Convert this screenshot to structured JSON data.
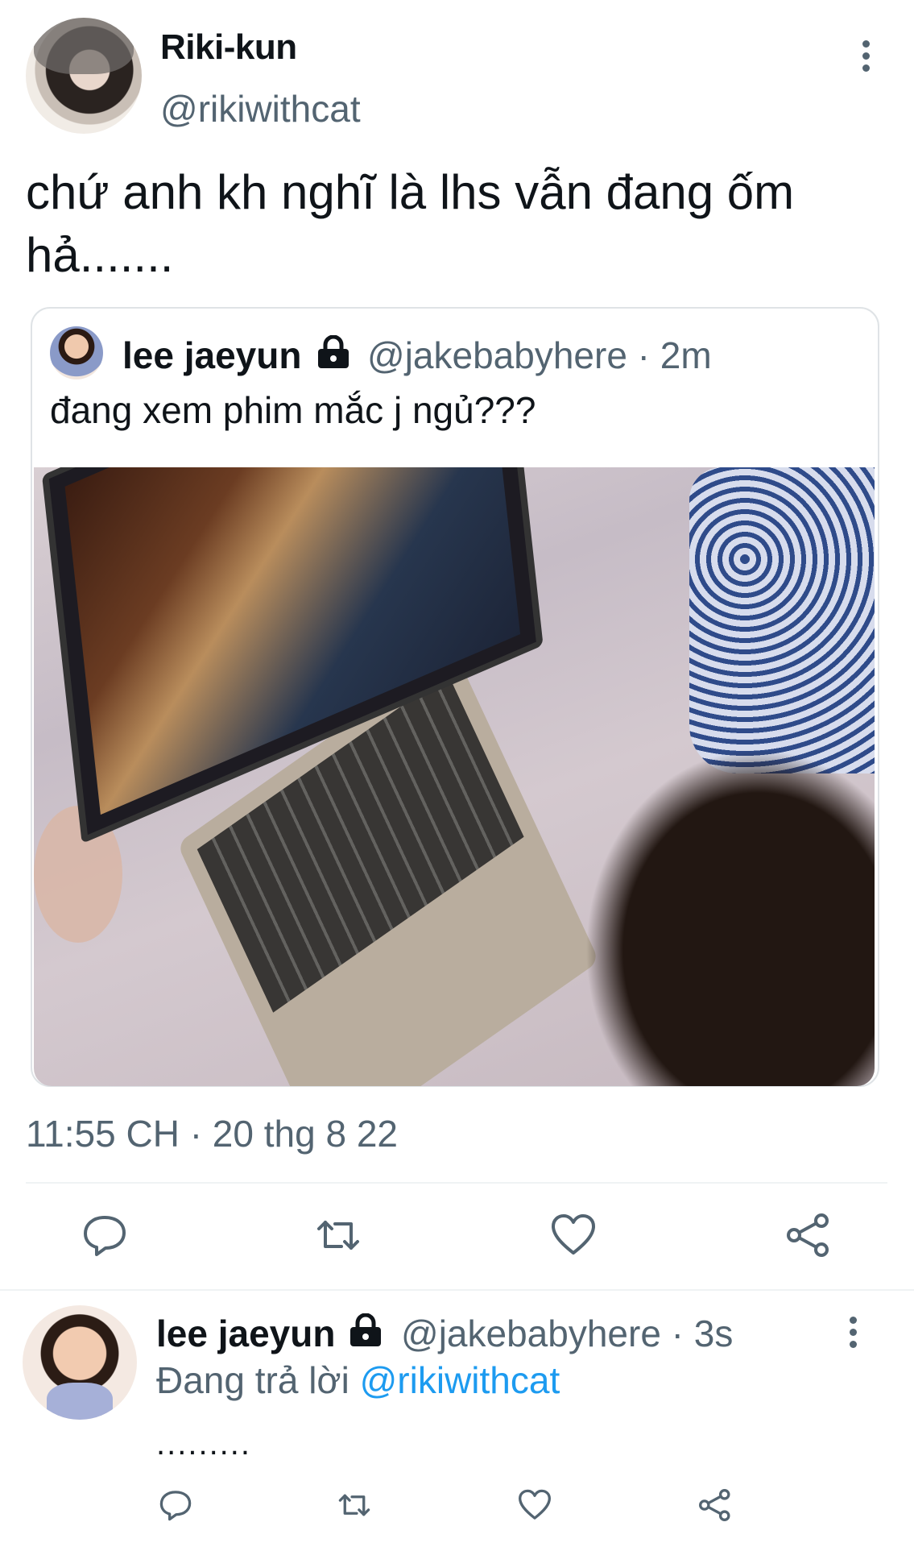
{
  "tweet": {
    "display_name": "Riki-kun",
    "handle": "@rikiwithcat",
    "text": "chứ anh kh nghĩ là lhs vẫn đang ốm hả.......",
    "timestamp": "11:55 CH · 20 thg 8 22"
  },
  "quote": {
    "display_name": "lee jaeyun",
    "handle_time": "@jakebabyhere · 2m",
    "text": "đang xem phim mắc j ngủ???"
  },
  "reply": {
    "display_name": "lee jaeyun",
    "handle_time": "@jakebabyhere · 3s",
    "replying_prefix": "Đang trả lời ",
    "replying_to": "@rikiwithcat",
    "text": "........."
  },
  "icons": {
    "more": "more-vertical-icon",
    "lock": "lock-icon",
    "reply": "comment-icon",
    "retweet": "retweet-icon",
    "like": "heart-icon",
    "share": "share-icon"
  },
  "colors": {
    "text_primary": "#0f1419",
    "text_secondary": "#536471",
    "link": "#1d9bf0",
    "divider": "#eff3f4"
  }
}
